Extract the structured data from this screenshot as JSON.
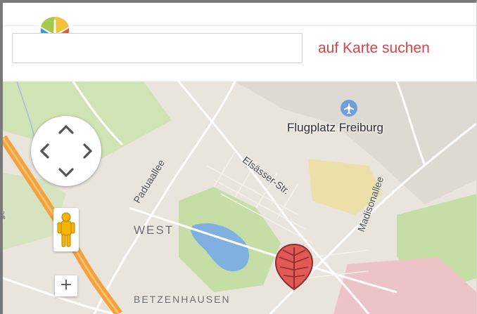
{
  "search": {
    "placeholder": "",
    "value": "",
    "button_label": "auf Karte suchen"
  },
  "map": {
    "poi_label": "Flugplatz Freiburg",
    "streets": [
      "Paduaallee",
      "Elsässer-Str.",
      "Madisonallee"
    ],
    "districts": [
      "WEST",
      "BETZENHAUSEN"
    ],
    "edge_label": "ege",
    "zoom_in_label": "+",
    "colors": {
      "land": "#e9e5dc",
      "park": "#c5dea6",
      "water": "#7fb0e0",
      "highway": "#f3a13b",
      "marker": "#e15a55",
      "accent": "#d6434b"
    }
  },
  "icons": {
    "logo": "leaf-logo-icon",
    "pan": "pan-control-icon",
    "pegman": "pegman-icon",
    "airport": "airport-icon",
    "marker": "leaf-marker-icon"
  }
}
